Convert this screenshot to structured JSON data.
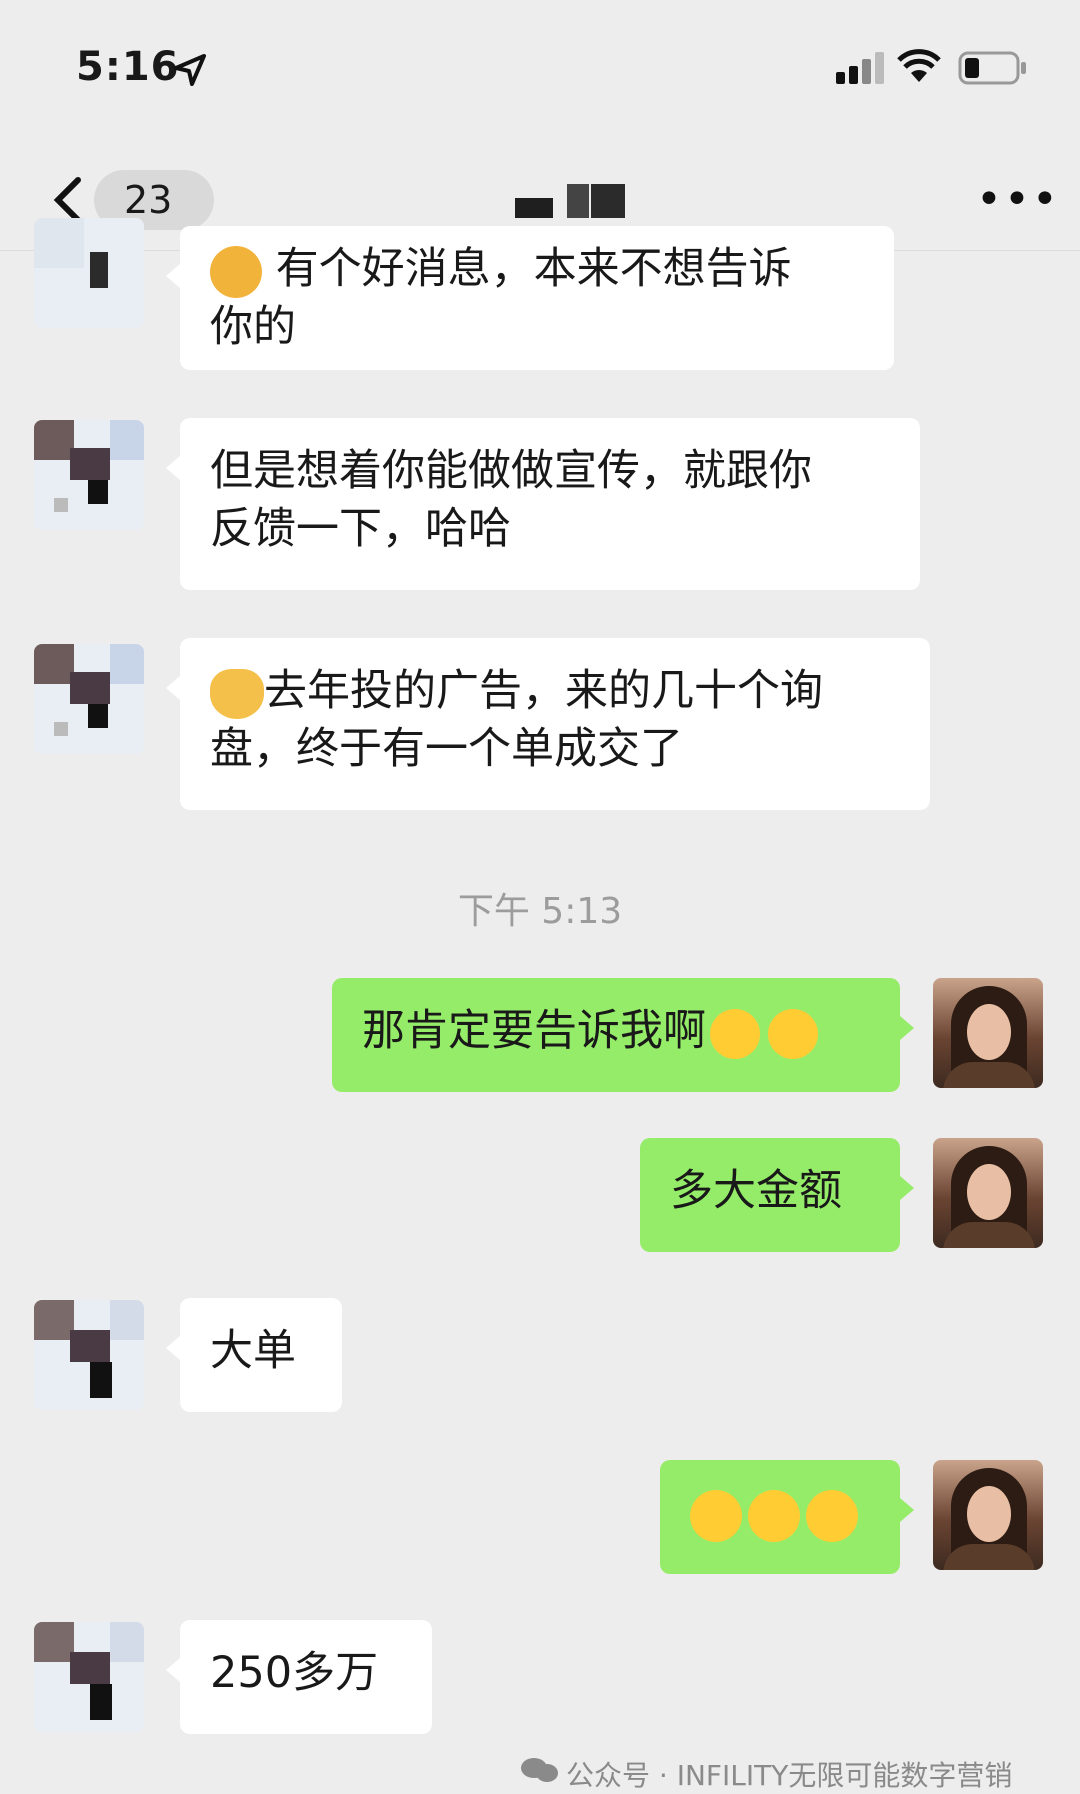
{
  "status": {
    "time": "5:16"
  },
  "nav": {
    "unread_count": "23"
  },
  "messages": [
    {
      "from": "other",
      "text_line1": "有个好消息，本来不想告诉",
      "text_line2": "你的"
    },
    {
      "from": "other",
      "text_line1": "但是想着你能做做宣传，就跟你",
      "text_line2": "反馈一下，哈哈"
    },
    {
      "from": "other",
      "text_line1": "去年投的广告，来的几十个询",
      "text_line2": "盘，终于有一个单成交了"
    },
    {
      "from": "self",
      "text": "那肯定要告诉我啊"
    },
    {
      "from": "self",
      "text": "多大金额"
    },
    {
      "from": "other",
      "text": "大单"
    },
    {
      "from": "self",
      "text": ""
    },
    {
      "from": "other",
      "text": "250多万"
    }
  ],
  "time_divider": "下午 5:13",
  "watermark": "公众号 · INFILITY无限可能数字营销",
  "colors": {
    "background": "#ededed",
    "self_bubble": "#95ec69",
    "other_bubble": "#ffffff"
  },
  "icons": [
    "location-arrow-icon",
    "signal-icon",
    "wifi-icon",
    "battery-icon",
    "back-arrow-icon",
    "more-icon",
    "cat-emoji-icon",
    "laughing-emoji-icon",
    "grin-emoji-icon",
    "wechat-icon"
  ]
}
